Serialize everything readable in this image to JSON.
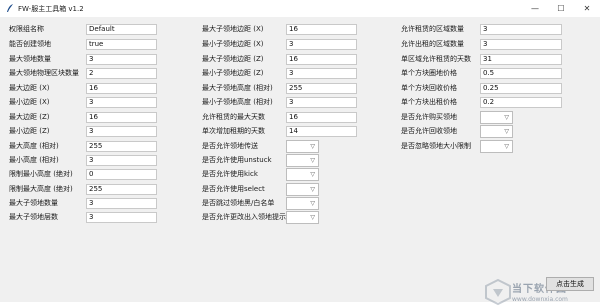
{
  "window": {
    "title": "FW-服主工具箱 v1.2",
    "minimize": "—",
    "maximize": "☐",
    "close": "✕"
  },
  "col1": [
    {
      "label": "权限组名称",
      "value": "Default"
    },
    {
      "label": "能否创建领地",
      "value": "true"
    },
    {
      "label": "最大领地数量",
      "value": "3"
    },
    {
      "label": "最大领地物理区块数量",
      "value": "2"
    },
    {
      "label": "最大边距 (X)",
      "value": "16"
    },
    {
      "label": "最小边距 (X)",
      "value": "3"
    },
    {
      "label": "最大边距 (Z)",
      "value": "16"
    },
    {
      "label": "最小边距 (Z)",
      "value": "3"
    },
    {
      "label": "最大高度 (相对)",
      "value": "255"
    },
    {
      "label": "最小高度 (相对)",
      "value": "3"
    },
    {
      "label": "限制最小高度 (绝对)",
      "value": "0"
    },
    {
      "label": "限制最大高度 (绝对)",
      "value": "255"
    },
    {
      "label": "最大子领地数量",
      "value": "3"
    },
    {
      "label": "最大子领地层数",
      "value": "3"
    }
  ],
  "col2_inputs": [
    {
      "label": "最大子领地边距 (X)",
      "value": "16"
    },
    {
      "label": "最小子领地边距 (X)",
      "value": "3"
    },
    {
      "label": "最大子领地边距 (Z)",
      "value": "16"
    },
    {
      "label": "最小子领地边距 (Z)",
      "value": "3"
    },
    {
      "label": "最大子领地高度 (相对)",
      "value": "255"
    },
    {
      "label": "最小子领地高度 (相对)",
      "value": "3"
    },
    {
      "label": "允许租赁的最大天数",
      "value": "16"
    },
    {
      "label": "单次增加租期的天数",
      "value": "14"
    }
  ],
  "col2_selects": [
    {
      "label": "是否允许领地传送"
    },
    {
      "label": "是否允许使用unstuck"
    },
    {
      "label": "是否允许使用kick"
    },
    {
      "label": "是否允许使用select"
    },
    {
      "label": "是否跳过领地黑/白名单"
    },
    {
      "label": "是否允许更改出入领地提示"
    }
  ],
  "col3_inputs": [
    {
      "label": "允许租赁的区域数量",
      "value": "3"
    },
    {
      "label": "允许出租的区域数量",
      "value": "3"
    },
    {
      "label": "单区域允许租赁的天数",
      "value": "31"
    },
    {
      "label": "单个方块圈地价格",
      "value": "0.5"
    },
    {
      "label": "单个方块回收价格",
      "value": "0.25"
    },
    {
      "label": "单个方块出租价格",
      "value": "0.2"
    }
  ],
  "col3_selects": [
    {
      "label": "是否允许购买领地"
    },
    {
      "label": "是否允许回收领地"
    },
    {
      "label": "是否忽略领地大小限制"
    }
  ],
  "generate_button": "点击生成",
  "watermark": {
    "text": "当下软件园",
    "url": "www.downxia.com"
  }
}
